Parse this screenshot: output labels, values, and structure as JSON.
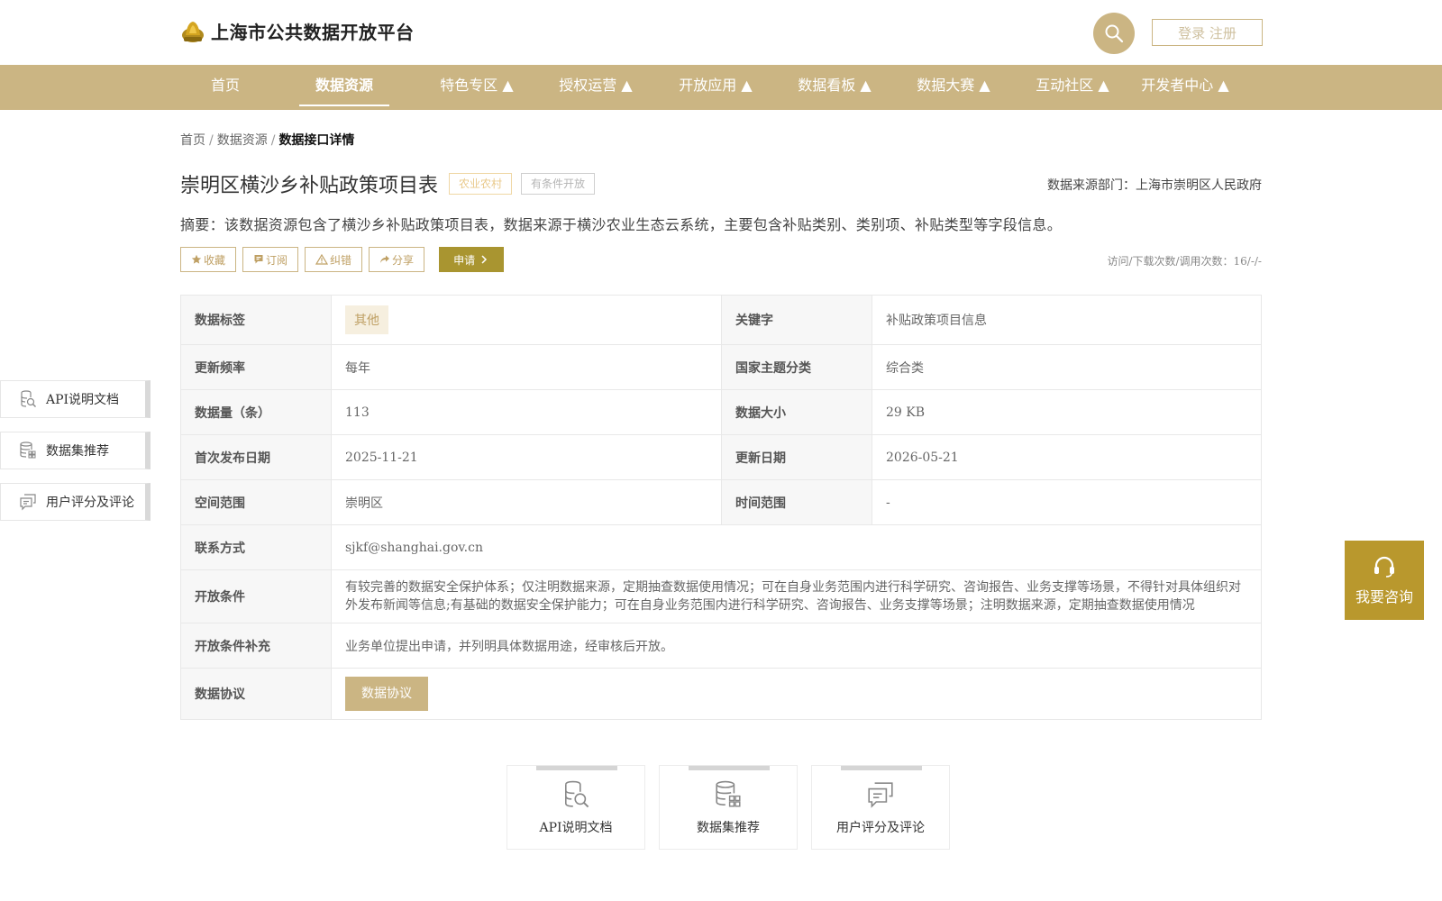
{
  "header": {
    "site_title": "上海市公共数据开放平台",
    "login_label": "登录 注册"
  },
  "nav": {
    "items": [
      {
        "label": "首页"
      },
      {
        "label": "数据资源"
      },
      {
        "label": "特色专区 ▲"
      },
      {
        "label": "授权运营 ▲"
      },
      {
        "label": "开放应用 ▲"
      },
      {
        "label": "数据看板 ▲"
      },
      {
        "label": "数据大赛 ▲"
      },
      {
        "label": "互动社区 ▲"
      },
      {
        "label": "开发者中心 ▲"
      }
    ],
    "active_index": 1
  },
  "breadcrumb": {
    "home": "首页",
    "section": "数据资源",
    "current": "数据接口详情",
    "separator": "/"
  },
  "dataset": {
    "title": "崇明区横沙乡补贴政策项目表",
    "category_tag": "农业农村",
    "open_type_tag": "有条件开放",
    "source_dept": "数据来源部门：上海市崇明区人民政府",
    "abstract": "摘要：该数据资源包含了横沙乡补贴政策项目表，数据来源于横沙农业生态云系统，主要包含补贴类别、类别项、补贴类型等字段信息。",
    "stats": "访问/下载次数/调用次数：16/-/-"
  },
  "actions": {
    "favorite": "收藏",
    "subscribe": "订阅",
    "report_error": "纠错",
    "share": "分享",
    "apply": "申请"
  },
  "table": {
    "tag_label": "数据标签",
    "tag_value": "其他",
    "keyword_label": "关键字",
    "keyword_value": "补贴政策项目信息",
    "frequency_label": "更新频率",
    "frequency_value": "每年",
    "theme_label": "国家主题分类",
    "theme_value": "综合类",
    "count_label": "数据量（条）",
    "count_value": "113",
    "size_label": "数据大小",
    "size_value": "29 KB",
    "first_pub_label": "首次发布日期",
    "first_pub_value": "2025-11-21",
    "update_label": "更新日期",
    "update_value": "2026-05-21",
    "space_label": "空间范围",
    "space_value": "崇明区",
    "time_label": "时间范围",
    "time_value": "-",
    "contact_label": "联系方式",
    "contact_value": "sjkf@shanghai.gov.cn",
    "condition_label": "开放条件",
    "condition_value": "有较完善的数据安全保护体系；仅注明数据来源，定期抽查数据使用情况；可在自身业务范围内进行科学研究、咨询报告、业务支撑等场景，不得针对具体组织对外发布新闻等信息;有基础的数据安全保护能力；可在自身业务范围内进行科学研究、咨询报告、业务支撑等场景；注明数据来源，定期抽查数据使用情况",
    "condition_extra_label": "开放条件补充",
    "condition_extra_value": "业务单位提出申请，并列明具体数据用途，经审核后开放。",
    "agreement_label": "数据协议",
    "agreement_button": "数据协议"
  },
  "side_panel": {
    "items": [
      {
        "label": "API说明文档",
        "icon": "document-search-icon"
      },
      {
        "label": "数据集推荐",
        "icon": "database-grid-icon"
      },
      {
        "label": "用户评分及评论",
        "icon": "comment-icon"
      }
    ]
  },
  "bottom_cards": {
    "items": [
      {
        "label": "API说明文档",
        "icon": "document-search-icon"
      },
      {
        "label": "数据集推荐",
        "icon": "database-grid-icon"
      },
      {
        "label": "用户评分及评论",
        "icon": "comment-icon"
      }
    ]
  },
  "consult": {
    "label": "我要咨询",
    "icon": "headset-icon"
  },
  "colors": {
    "brand": "#cbb583",
    "apply_button": "#a99530",
    "consult": "#b9982d",
    "tag_bg": "#f6efdf"
  }
}
